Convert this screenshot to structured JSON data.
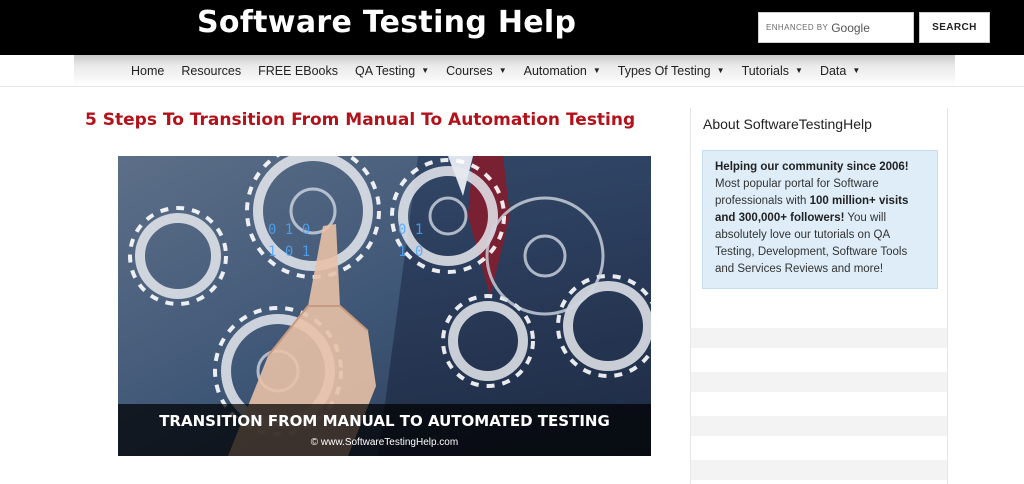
{
  "header": {
    "site_title": "Software Testing Help",
    "search": {
      "enhanced_label": "ENHANCED BY",
      "brand": "Google",
      "button_label": "SEARCH"
    }
  },
  "nav": {
    "items": [
      {
        "label": "Home",
        "dropdown": false
      },
      {
        "label": "Resources",
        "dropdown": false
      },
      {
        "label": "FREE EBooks",
        "dropdown": false
      },
      {
        "label": "QA Testing",
        "dropdown": true
      },
      {
        "label": "Courses",
        "dropdown": true
      },
      {
        "label": "Automation",
        "dropdown": true
      },
      {
        "label": "Types Of Testing",
        "dropdown": true
      },
      {
        "label": "Tutorials",
        "dropdown": true
      },
      {
        "label": "Data",
        "dropdown": true
      }
    ]
  },
  "article": {
    "title": "5 Steps To Transition From Manual To Automation Testing",
    "hero": {
      "caption_title": "TRANSITION FROM MANUAL TO AUTOMATED TESTING",
      "caption_sub": "© www.SoftwareTestingHelp.com"
    }
  },
  "sidebar": {
    "heading": "About SoftwareTestingHelp",
    "about": {
      "lead": "Helping our community since 2006!",
      "text1": " Most popular portal for Software professionals with ",
      "bold1": "100 million+ visits and 300,000+ followers!",
      "text2": " You will absolutely love our tutorials on QA Testing, Development, Software Tools and Services Reviews and more!"
    }
  },
  "colors": {
    "title_red": "#b3121a",
    "header_bg": "#000000",
    "about_bg": "#deedf8"
  }
}
